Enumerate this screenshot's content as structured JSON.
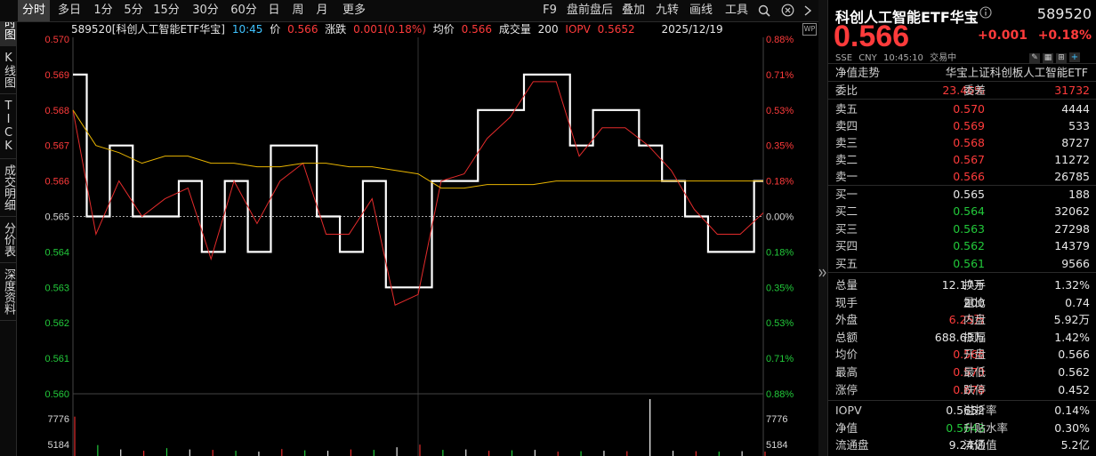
{
  "left_rail": [
    "分时图",
    "K线图",
    "TICK",
    "成交明细",
    "分价表",
    "深度资料"
  ],
  "tabs": [
    "分时",
    "多日",
    "1分",
    "5分",
    "15分",
    "30分",
    "60分",
    "日",
    "周",
    "月",
    "更多"
  ],
  "tools": [
    "F9",
    "盘前盘后",
    "叠加",
    "九转",
    "画线",
    "工具"
  ],
  "info": {
    "code_name": "589520[科创人工智能ETF华宝]",
    "time": "10:45",
    "price_label": "价",
    "price": "0.566",
    "change_label": "涨跌",
    "change": "0.001(0.18%)",
    "avg_label": "均价",
    "avg": "0.566",
    "vol_label": "成交量",
    "vol": "200",
    "iopv_label": "IOPV",
    "iopv": "0.5652",
    "date": "2025/12/19"
  },
  "chart_data": {
    "type": "line",
    "price_ticks": [
      "0.570",
      "0.569",
      "0.568",
      "0.567",
      "0.566",
      "0.565",
      "0.564",
      "0.563",
      "0.562",
      "0.561",
      "0.560"
    ],
    "pct_ticks": [
      "0.88%",
      "0.71%",
      "0.53%",
      "0.35%",
      "0.18%",
      "0.00%",
      "0.18%",
      "0.35%",
      "0.53%",
      "0.71%",
      "0.88%"
    ],
    "vol_ticks": [
      "7776",
      "5184"
    ],
    "ylim": [
      0.56,
      0.57
    ],
    "prev_close": 0.565,
    "series": [
      {
        "color": "#ffffff",
        "values": [
          0.569,
          0.565,
          0.567,
          0.565,
          0.565,
          0.566,
          0.564,
          0.566,
          0.564,
          0.567,
          0.567,
          0.565,
          0.564,
          0.566,
          0.563,
          0.563,
          0.566,
          0.566,
          0.568,
          0.568,
          0.569,
          0.569,
          0.567,
          0.568,
          0.568,
          0.567,
          0.566,
          0.565,
          0.564,
          0.564,
          0.566
        ]
      },
      {
        "color": "#e32b2b",
        "values": [
          0.568,
          0.5645,
          0.566,
          0.565,
          0.5655,
          0.5658,
          0.5638,
          0.566,
          0.5648,
          0.566,
          0.5665,
          0.5645,
          0.5645,
          0.5655,
          0.5625,
          0.5628,
          0.566,
          0.5662,
          0.5672,
          0.5678,
          0.5688,
          0.5688,
          0.5667,
          0.5675,
          0.5675,
          0.567,
          0.5663,
          0.5652,
          0.5645,
          0.5645,
          0.5651
        ]
      },
      {
        "color": "#e8b400",
        "values": [
          0.568,
          0.567,
          0.5668,
          0.5665,
          0.5667,
          0.5667,
          0.5665,
          0.5665,
          0.5664,
          0.5664,
          0.5665,
          0.5665,
          0.5664,
          0.5664,
          0.5663,
          0.5662,
          0.5658,
          0.5658,
          0.5659,
          0.5659,
          0.5659,
          0.566,
          0.566,
          0.566,
          0.566,
          0.566,
          0.566,
          0.566,
          0.566,
          0.566,
          0.566
        ]
      }
    ],
    "volumes": [
      9000,
      2500,
      1500,
      1200,
      1800,
      1500,
      1400,
      1200,
      1000,
      1600,
      1300,
      1200,
      1500,
      1400,
      2000,
      2600,
      1400,
      1500,
      1200,
      1300,
      1400,
      1000,
      1100,
      1200,
      1100,
      13000,
      1200,
      1100,
      1000,
      1100,
      1000
    ]
  },
  "panel": {
    "title": "科创人工智能ETF华宝",
    "code": "589520",
    "price": "0.566",
    "change": "+0.001",
    "change_pct": "+0.18%",
    "meta": [
      "SSE",
      "CNY",
      "10:45:10",
      "交易中"
    ],
    "nav_label": "净值走势",
    "fund_name": "华宝上证科创板人工智能ETF",
    "weibi_label": "委比",
    "weibi": "23.46%",
    "weicha_label": "委差",
    "weicha": "31732",
    "asks": [
      {
        "label": "卖五",
        "price": "0.570",
        "vol": "4444"
      },
      {
        "label": "卖四",
        "price": "0.569",
        "vol": "533"
      },
      {
        "label": "卖三",
        "price": "0.568",
        "vol": "8727"
      },
      {
        "label": "卖二",
        "price": "0.567",
        "vol": "11272"
      },
      {
        "label": "卖一",
        "price": "0.566",
        "vol": "26785"
      }
    ],
    "bids": [
      {
        "label": "买一",
        "price": "0.565",
        "vol": "188"
      },
      {
        "label": "买二",
        "price": "0.564",
        "vol": "32062"
      },
      {
        "label": "买三",
        "price": "0.563",
        "vol": "27298"
      },
      {
        "label": "买四",
        "price": "0.562",
        "vol": "14379"
      },
      {
        "label": "买五",
        "price": "0.561",
        "vol": "9566"
      }
    ],
    "stats": [
      {
        "l1": "总量",
        "v1": "12.17万",
        "l2": "换手",
        "v2": "1.32%",
        "c1": "white",
        "c2": "white"
      },
      {
        "l1": "现手",
        "v1": "200",
        "l2": "量比",
        "v2": "0.74",
        "c1": "white",
        "c2": "white"
      },
      {
        "l1": "外盘",
        "v1": "6.25万",
        "l2": "内盘",
        "v2": "5.92万",
        "c1": "red",
        "c2": "green"
      },
      {
        "l1": "总额",
        "v1": "688.63万",
        "l2": "振幅",
        "v2": "1.42%",
        "c1": "white",
        "c2": "white"
      },
      {
        "l1": "均价",
        "v1": "0.566",
        "l2": "开盘",
        "v2": "0.566",
        "c1": "red",
        "c2": "red"
      },
      {
        "l1": "最高",
        "v1": "0.570",
        "l2": "最低",
        "v2": "0.562",
        "c1": "red",
        "c2": "green"
      },
      {
        "l1": "涨停",
        "v1": "0.678",
        "l2": "跌停",
        "v2": "0.452",
        "c1": "red",
        "c2": "green"
      },
      {
        "l1": "IOPV",
        "v1": "0.5652",
        "l2": "溢折率",
        "v2": "0.14%",
        "c1": "white",
        "c2": "red"
      },
      {
        "l1": "净值",
        "v1": "0.5643",
        "l2": "升贴水率",
        "v2": "0.30%",
        "c1": "green",
        "c2": "red"
      },
      {
        "l1": "流通盘",
        "v1": "9.24亿",
        "l2": "流通值",
        "v2": "5.2亿",
        "c1": "white",
        "c2": "white"
      }
    ]
  }
}
